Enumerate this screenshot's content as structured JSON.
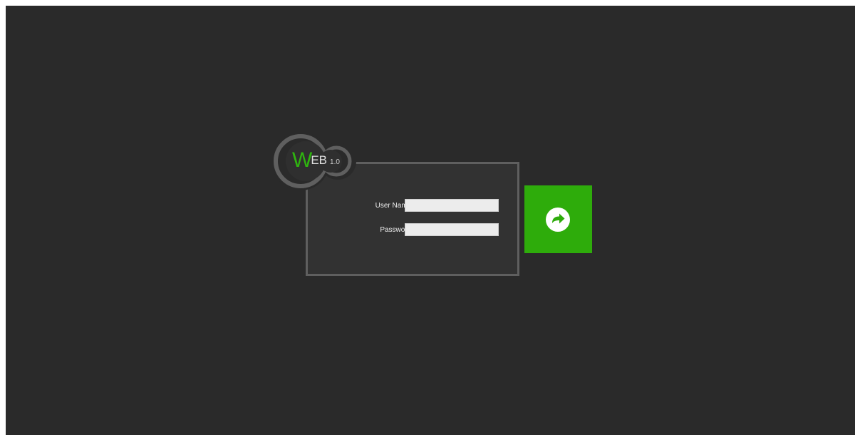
{
  "app": {
    "logo": {
      "initial": "W",
      "rest": "EB",
      "version": "1.0"
    }
  },
  "login": {
    "username_label": "User Name:",
    "username_value": "",
    "password_label": "Password:",
    "password_value": "",
    "submit_icon": "arrow-right-circle-icon"
  },
  "colors": {
    "background": "#2a2a2a",
    "panel_border": "#5f5f5f",
    "accent_green": "#2eac0b"
  }
}
